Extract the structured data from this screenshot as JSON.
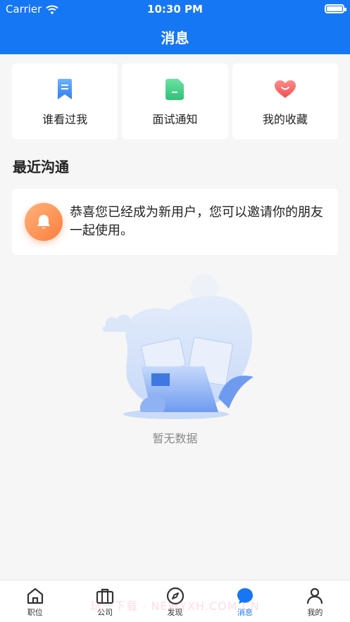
{
  "status": {
    "carrier": "Carrier",
    "time": "10:30 PM"
  },
  "header": {
    "title": "消息"
  },
  "quick": [
    {
      "label": "谁看过我",
      "icon": "bookmark-icon"
    },
    {
      "label": "面试通知",
      "icon": "document-icon"
    },
    {
      "label": "我的收藏",
      "icon": "heart-icon"
    }
  ],
  "section": {
    "title": "最近沟通"
  },
  "notice": {
    "text": "恭喜您已经成为新用户，您可以邀请你的朋友一起使用。",
    "icon": "bell-icon"
  },
  "empty": {
    "text": "暂无数据"
  },
  "tabs": [
    {
      "label": "职位",
      "icon": "home-icon"
    },
    {
      "label": "公司",
      "icon": "briefcase-icon"
    },
    {
      "label": "发现",
      "icon": "compass-icon"
    },
    {
      "label": "消息",
      "icon": "message-icon"
    },
    {
      "label": "我的",
      "icon": "user-icon"
    }
  ],
  "watermark": "玩一下载 · NEWYXH.COM.CN",
  "colors": {
    "primary": "#1677f5",
    "background": "#f6f6f6",
    "bell": "#fb7e3e"
  }
}
